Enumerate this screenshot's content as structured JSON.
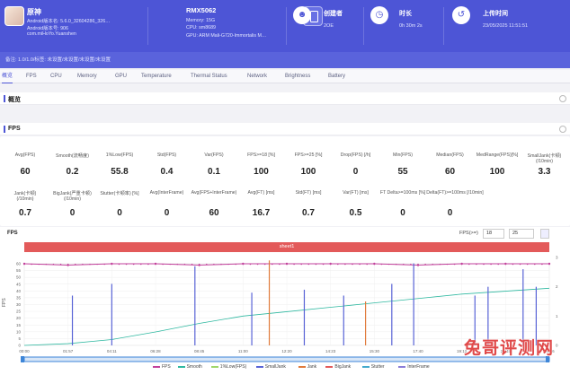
{
  "header": {
    "app": {
      "title": "原神",
      "lines": [
        "Android版本名: 5.6.0_32604286_326…",
        "Android版本号: 906",
        "com.miHoYo.Yuanshen"
      ]
    },
    "device": {
      "title": "RMX5062",
      "lines": [
        "Memory: 15G",
        "CPU: sm8689",
        "GPU: ARM Mali-G720-Immortalis M…"
      ]
    },
    "creator": {
      "label": "创建者",
      "value": "2OE"
    },
    "duration": {
      "label": "时长",
      "value": "0h 30m 2s"
    },
    "upload": {
      "label": "上传时间",
      "value": "23/05/2025 11:51:51"
    }
  },
  "banner": "备注: 1.0/1.0/标签: 未设置/未设置/未设置/未设置",
  "tabs": [
    "概览",
    "FPS",
    "CPU",
    "Memory",
    "GPU",
    "Temperature",
    "Thermal Status",
    "Network",
    "Brightness",
    "Battery"
  ],
  "sections": {
    "overview": "概览",
    "fps": "FPS"
  },
  "fps_stats_row1": [
    {
      "label": "Avg(FPS)",
      "value": "60"
    },
    {
      "label": "Smooth(流畅度)",
      "value": "0.2"
    },
    {
      "label": "1%Low(FPS)",
      "value": "55.8"
    },
    {
      "label": "Std(FPS)",
      "value": "0.4"
    },
    {
      "label": "Var(FPS)",
      "value": "0.1"
    },
    {
      "label": "FPS>=18 [%]",
      "value": "100"
    },
    {
      "label": "FPS>=25 [%]",
      "value": "100"
    },
    {
      "label": "Drop(FPS) [/h]",
      "value": "0"
    },
    {
      "label": "Min(FPS)",
      "value": "55"
    },
    {
      "label": "Median(FPS)",
      "value": "60"
    },
    {
      "label": "MedRange(FPS)[%]",
      "value": "100"
    },
    {
      "label": "SmallJank(卡顿)\n(/10min)",
      "value": "3.3"
    }
  ],
  "fps_stats_row2": [
    {
      "label": "Jank(卡顿)\n(/10min)",
      "value": "0.7"
    },
    {
      "label": "BigJank(严重卡顿)\n(/10min)",
      "value": "0"
    },
    {
      "label": "Stutter(卡顿率) [%]",
      "value": "0"
    },
    {
      "label": "Avg(InterFrame)",
      "value": "0"
    },
    {
      "label": "Avg(FPS+InterFrame)",
      "value": "60"
    },
    {
      "label": "Avg(FT) [ms]",
      "value": "16.7"
    },
    {
      "label": "Std(FT) [ms]",
      "value": "0.7"
    },
    {
      "label": "Var(FT) [ms]",
      "value": "0.5"
    },
    {
      "label": "FT Delta>=100ms [%]",
      "value": "0"
    },
    {
      "label": "Delta(FT)>=100ms [/10min]",
      "value": "0"
    }
  ],
  "fps_chart": {
    "title": "FPS",
    "fps_threshold_label": "FPS(>=)",
    "threshold_a": "18",
    "threshold_b": "25",
    "sheet_label": "sheet1",
    "ylabel": "FPS"
  },
  "chart_data": {
    "type": "line",
    "title": "FPS",
    "ylabel": "FPS",
    "ylim": [
      0,
      60
    ],
    "yticks": [
      60,
      55,
      50,
      45,
      40,
      35,
      30,
      25,
      20,
      15,
      10,
      5,
      0
    ],
    "right_yticks": [
      "3",
      "2",
      "1",
      "0"
    ],
    "x_ticks": [
      "00:00",
      "01:57",
      "04:11",
      "06:28",
      "08:45",
      "11:00",
      "12:20",
      "14:23",
      "15:30",
      "17:40",
      "19:12",
      "21:45",
      "24:16"
    ],
    "series": [
      {
        "name": "FPS",
        "color": "#c2429c",
        "x": [
          0,
          1,
          2,
          3,
          4,
          5,
          6,
          7,
          8,
          9,
          10,
          11,
          12
        ],
        "values": [
          60,
          59,
          60,
          60,
          59,
          60,
          60,
          60,
          60,
          59,
          60,
          60,
          60
        ]
      },
      {
        "name": "Smooth",
        "color": "#2eb8a0",
        "x": [
          0,
          1,
          2,
          3,
          4,
          5,
          6,
          7,
          8,
          9,
          10,
          11,
          12
        ],
        "values": [
          0,
          0.06,
          0.2,
          0.46,
          0.75,
          1.0,
          1.15,
          1.3,
          1.45,
          1.6,
          1.75,
          1.85,
          1.95
        ]
      },
      {
        "name": "SmallJank",
        "color": "#5863d6",
        "x": [
          1.1,
          2.0,
          3.9,
          5.2,
          6.4,
          7.3,
          8.4,
          8.9,
          10.3,
          10.6,
          11.4,
          11.7,
          12.5
        ],
        "values": [
          1.7,
          2.1,
          2.7,
          1.8,
          1.9,
          1.7,
          2.1,
          2.8,
          1.7,
          2.0,
          2.6,
          2.0,
          2.0
        ]
      },
      {
        "name": "Jank",
        "color": "#e07a3a",
        "x": [
          5.6,
          7.8
        ],
        "values": [
          2.9,
          1.5
        ]
      }
    ],
    "legend": [
      "FPS",
      "Smooth",
      "1%Low(FPS)",
      "SmallJank",
      "Jank",
      "BigJank",
      "Stutter",
      "InterFrame"
    ],
    "legend_colors": [
      "#c2429c",
      "#2eb8a0",
      "#9fd66a",
      "#5863d6",
      "#e07a3a",
      "#e35a5a",
      "#44aacc",
      "#8a7cd8"
    ],
    "legend_placement": "bottom",
    "grid": true
  }
}
